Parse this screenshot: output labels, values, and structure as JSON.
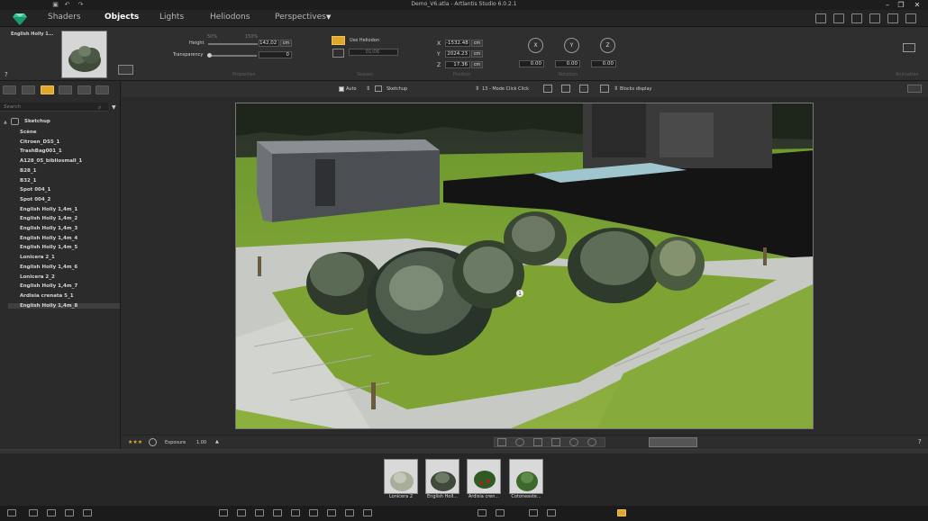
{
  "window": {
    "title": "Demo_V6.atla - Artlantis Studio 6.0.2.1"
  },
  "menu": {
    "items": [
      "Shaders",
      "Objects",
      "Lights",
      "Heliodons",
      "Perspectives"
    ],
    "active": "Objects"
  },
  "inspector": {
    "object_name": "English Holly 1...",
    "help": "?",
    "height_label": "Height",
    "height_value": "142,02",
    "height_unit": "cm",
    "height_scale_min": "50%",
    "height_scale_max": "150%",
    "transparency_label": "Transparency",
    "transparency_value": "0",
    "properties_caption": "Properties",
    "use_heliodon_label": "Use Heliodon",
    "season_value": "01/06",
    "season_caption": "Season",
    "x_value": "-1532.48",
    "y_value": "2024.23",
    "z_value": "17.36",
    "coord_unit": "cm",
    "position_caption": "Position",
    "rot_x": "X",
    "rot_y": "Y",
    "rot_z": "Z",
    "rot_x_value": "0.00",
    "rot_y_value": "0.00",
    "rot_z_value": "0.00",
    "rotation_caption": "Rotation",
    "animation_caption": "Animation"
  },
  "left_panel": {
    "search_placeholder": "Search",
    "root": "Sketchup",
    "items": [
      "Scène",
      "Citroen_DS5_1",
      "TrashBag001_1",
      "A128_05_bibliosmall_1",
      "B28_1",
      "B32_1",
      "Spot 004_1",
      "Spot 004_2",
      "English Holly 1,4m_1",
      "English Holly 1,4m_2",
      "English Holly 1,4m_3",
      "English Holly 1,4m_4",
      "English Holly 1,4m_5",
      "Lonicera 2_1",
      "English Holly 1,4m_6",
      "Lonicera 2_2",
      "English Holly 1,4m_7",
      "Ardisia crenata 5_1",
      "English Holly 1,4m_8"
    ],
    "selected_index": 18
  },
  "viewport_toolbar": {
    "auto_label": "Auto",
    "sketchup_label": "Sketchup",
    "mode_label": "13 - Mode Click Click",
    "blocks_label": "Blocks display"
  },
  "viewport": {
    "marker": "1"
  },
  "viewport_bottom": {
    "stars": "★★★",
    "exposure_label": "Exposure",
    "exposure_value": "1.00",
    "help": "?"
  },
  "library": {
    "thumbnails": [
      "Lonicera 2",
      "English Holl...",
      "Ardisia cren...",
      "Cotoneaste..."
    ]
  },
  "colors": {
    "accent": "#e0a82a",
    "logo": "#2fc08f",
    "grass": "#7fa332"
  }
}
